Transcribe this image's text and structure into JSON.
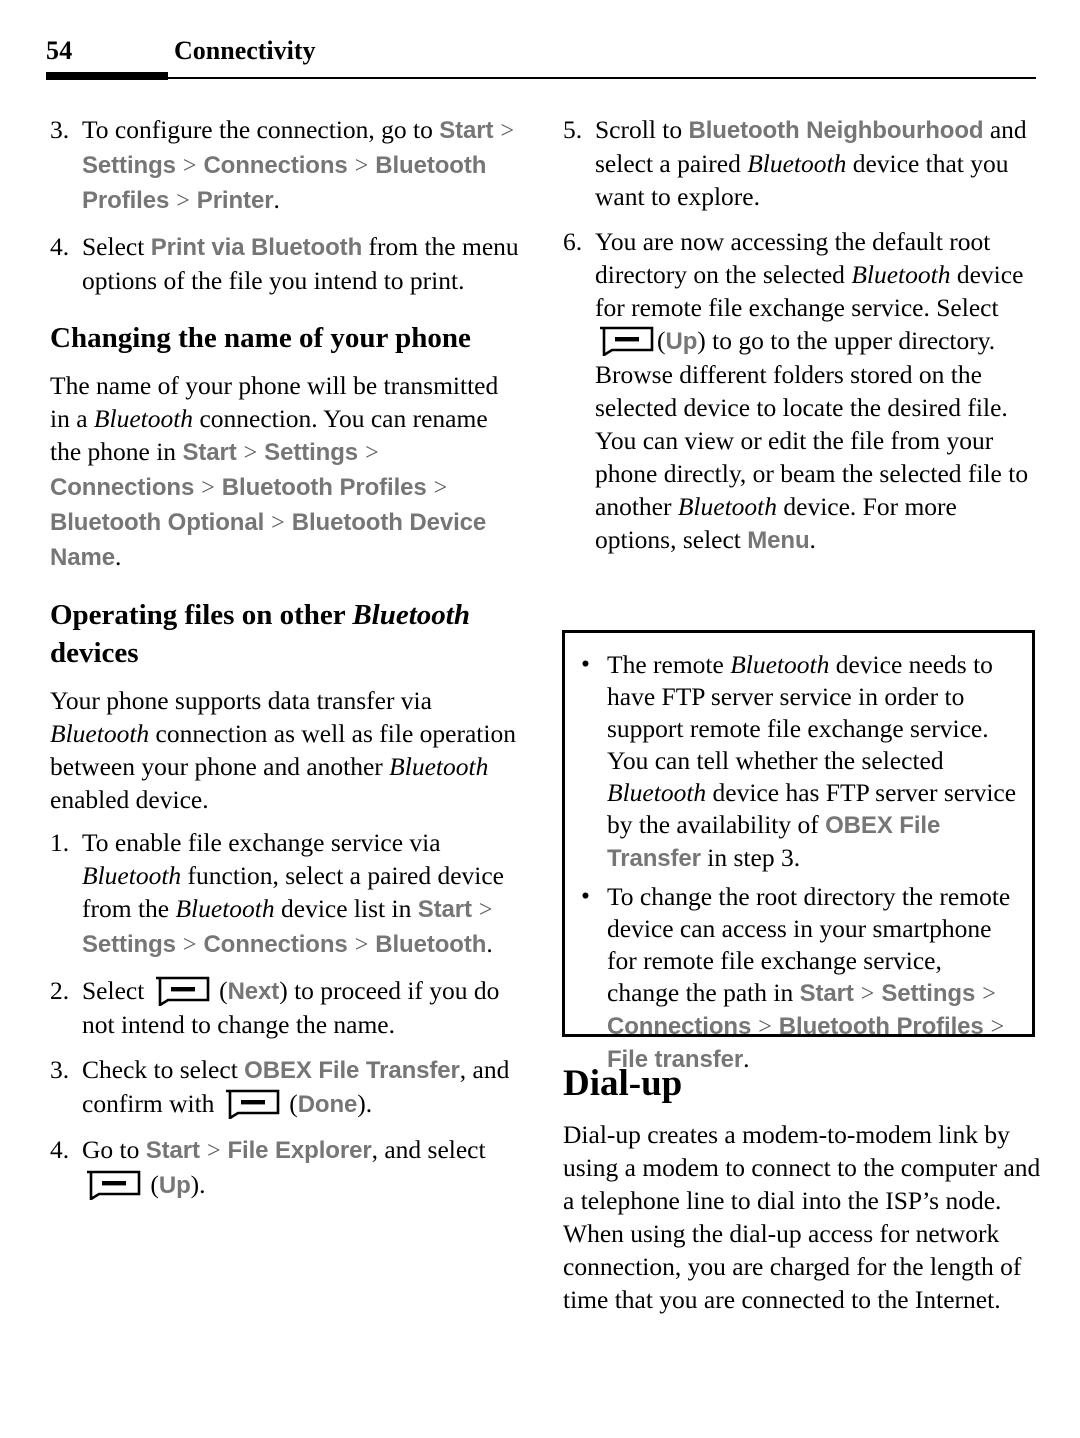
{
  "header": {
    "page_number": "54",
    "chapter_title": "Connectivity"
  },
  "left_column": {
    "steps_printer": [
      {
        "num": "3.",
        "text_before": "To configure the connection, go to ",
        "path": [
          "Start",
          "Settings",
          "Connections",
          "Bluetooth Profiles",
          "Printer"
        ],
        "text_after": "."
      },
      {
        "num": "4.",
        "text_before": "Select ",
        "ui_term": "Print via Bluetooth",
        "text_after": " from the menu options of the file you intend to print."
      }
    ],
    "heading_changing_name": "Changing the name of your phone",
    "para_changing_name": {
      "p1": "The name of your phone will be transmitted in a ",
      "italic1": "Bluetooth",
      "p2": " connection. You can rename the phone in ",
      "path": [
        "Start",
        "Settings",
        "Connections",
        "Bluetooth Profiles",
        "Bluetooth Optional",
        "Bluetooth Device Name"
      ],
      "p3": "."
    },
    "heading_operating_files": {
      "part1": "Operating files on other ",
      "italic": "Bluetooth",
      "part2": " devices"
    },
    "para_operating_files": {
      "p1": "Your phone supports data transfer via ",
      "italic1": "Bluetooth",
      "p2": " connection as well as file operation between your phone and another ",
      "italic2": "Bluetooth",
      "p3": " enabled device."
    },
    "steps_files": [
      {
        "num": "1.",
        "p1": "To enable file exchange service via ",
        "italic1": "Bluetooth",
        "p2": " function, select a paired device from the ",
        "italic2": "Bluetooth",
        "p3": " device list in ",
        "path": [
          "Start",
          "Settings",
          "Connections",
          "Bluetooth"
        ],
        "p4": "."
      },
      {
        "num": "2.",
        "p1": "Select ",
        "icon": "softkey-icon",
        "label": "(Next)",
        "label_ui": "Next",
        "p2": " to proceed if you do not intend to change the name."
      },
      {
        "num": "3.",
        "p1": "Check to select ",
        "ui_term": "OBEX File Transfer",
        "p2": ", and confirm with ",
        "icon": "softkey-icon",
        "label_ui": "Done",
        "p3": "."
      },
      {
        "num": "4.",
        "p1": "Go to ",
        "path": [
          "Start",
          "File Explorer"
        ],
        "p2": ", and select ",
        "icon": "softkey-icon",
        "label_ui": "Up",
        "p3": "."
      }
    ]
  },
  "right_column": {
    "steps": [
      {
        "num": "5.",
        "p1": "Scroll to ",
        "ui_term": "Bluetooth Neighbourhood",
        "p2": " and select a paired ",
        "italic1": "Bluetooth",
        "p3": " device that you want to explore."
      },
      {
        "num": "6.",
        "p1": "You are now accessing the default root directory on the selected ",
        "italic1": "Bluetooth",
        "p2": " device for remote file exchange service. Select ",
        "icon": "softkey-icon",
        "label_ui": "Up",
        "p3": " to go to the upper directory.",
        "p4": "Browse different folders stored on the selected device to locate the desired file. You can view or edit the file from your phone directly, or beam the selected file to another ",
        "italic2": "Bluetooth",
        "p5": " device. For more options, select ",
        "ui_term2": "Menu",
        "p6": "."
      }
    ],
    "note_box": {
      "bullets": [
        {
          "p1": "The remote ",
          "italic1": "Bluetooth",
          "p2": " device needs to have FTP server service in order to support remote file exchange service. You can tell whether the selected ",
          "italic2": "Bluetooth",
          "p3": " device has FTP server service by the availability of ",
          "ui_term": "OBEX File Transfer",
          "p4": " in step 3."
        },
        {
          "p1": "To change the root directory the remote device can access in your smartphone for remote file exchange service, change the path in ",
          "path": [
            "Start",
            "Settings",
            "Connections",
            "Bluetooth Profiles",
            "File transfer"
          ],
          "p2": "."
        }
      ]
    },
    "heading_dialup": "Dial-up",
    "para_dialup": "Dial-up creates a modem-to-modem link by using a modem to connect to the computer and a telephone line to dial into the ISP’s node. When using the dial-up access for network connection, you are charged for the length of time that you are connected to the Internet."
  },
  "colors": {
    "ui_term_gray": "#767676",
    "separator_gray": "#5b5b5b",
    "rule_black": "#000000"
  }
}
